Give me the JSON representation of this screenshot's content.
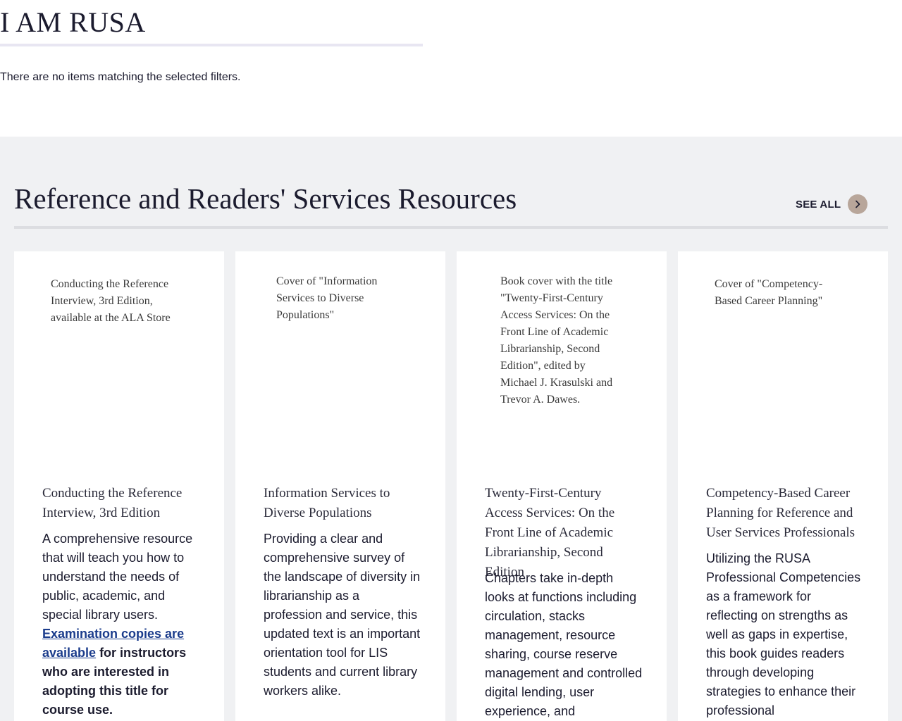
{
  "page": {
    "title": "I AM RUSA",
    "empty_message": "There are no items matching the selected filters."
  },
  "section": {
    "heading": "Reference and Readers' Services Resources",
    "see_all_label": "SEE ALL"
  },
  "cards": [
    {
      "image_alt": "Conducting the Reference Interview, 3rd Edition, available at the ALA Store",
      "title": "Conducting the Reference Interview, 3rd Edition",
      "description": "A comprehensive resource that will teach you how to understand the needs of public, academic, and special library users.",
      "link_text": "Examination copies are available",
      "link_suffix": " for instructors who are interested in adopting this title for course use."
    },
    {
      "image_alt": "Cover of \"Information Services to Diverse Populations\"",
      "title": "Information Services to Diverse Populations",
      "description": "Providing a clear and comprehensive survey of the landscape of diversity in librarianship as a profession and service, this updated text is an important orientation tool for LIS students and current library workers alike."
    },
    {
      "image_alt": "Book cover with the title \"Twenty-First-Century Access Services: On the Front Line of Academic Librarianship, Second Edition\", edited by Michael J. Krasulski and Trevor A. Dawes.",
      "title": "Twenty-First-Century Access Services: On the Front Line of Academic Librarianship, Second Edition",
      "description": "Chapters take in-depth looks at functions including circulation, stacks management, resource sharing, course reserve management and controlled digital lending, user experience, and"
    },
    {
      "image_alt": "Cover of \"Competency-Based Career Planning\"",
      "title": "Competency-Based Career Planning for Reference and User Services Professionals",
      "description": "Utilizing the RUSA Professional Competencies as a framework for reflecting on strengths as well as gaps in expertise, this book guides readers through developing strategies to enhance their professional"
    }
  ],
  "icons": {
    "see_all": "chevron-right-icon"
  },
  "colors": {
    "section_background": "#f0f1f3",
    "see_all_circle": "#b8a69a",
    "link": "#1b3c8c"
  }
}
